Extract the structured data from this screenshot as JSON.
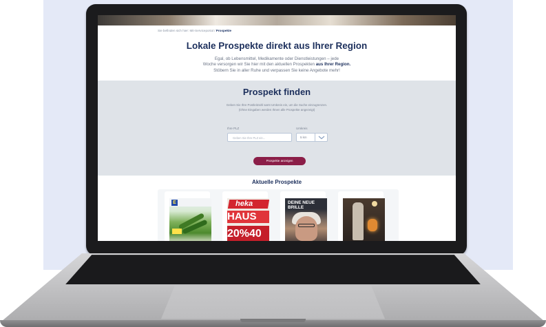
{
  "breadcrumb": {
    "prefix": "Sie befinden sich hier: Mit-Serviceportal /",
    "current": "Prospekte"
  },
  "headline": "Lokale Prospekte direkt aus Ihrer Region",
  "intro": {
    "line1": "Egal, ob Lebensmittel, Medikamente oder Dienstleistungen – jede",
    "line2_start": "Woche versorgen wir Sie hier mit den aktuellen Prospekten",
    "line2_bold": "aus Ihrer Region.",
    "line3": "Stöbern Sie in aller Ruhe und verpassen Sie keine Angebote mehr!"
  },
  "finder": {
    "title": "Prospekt finden",
    "desc_line1": "Geben Sie Ihre Postleitzahl samt Umkreis ein, um die Suche einzugrenzen.",
    "desc_line2": "(Ohne Eingaben werden Ihnen alle Prospekte angezeigt)",
    "plz_label": "Ihre PLZ",
    "plz_placeholder": "Geben Sie Ihre PLZ ein...",
    "umkreis_label": "Umkreis",
    "umkreis_value": "5 km",
    "button_label": "Prospekte anzeigen"
  },
  "current": {
    "title": "Aktuelle Prospekte",
    "brochures": [
      {
        "logo": "E",
        "name": "edeka-brochure"
      },
      {
        "brand": "heka",
        "headline": "HAUS",
        "percent": "20%40"
      },
      {
        "headline": "DEINE NEUE BRILLE"
      },
      {
        "name": "fashion-brochure"
      }
    ]
  },
  "colors": {
    "navy": "#1c2f5c",
    "button": "#8b1e48",
    "finder_bg": "#dfe3e8",
    "page_bg": "#e4e9f7"
  }
}
